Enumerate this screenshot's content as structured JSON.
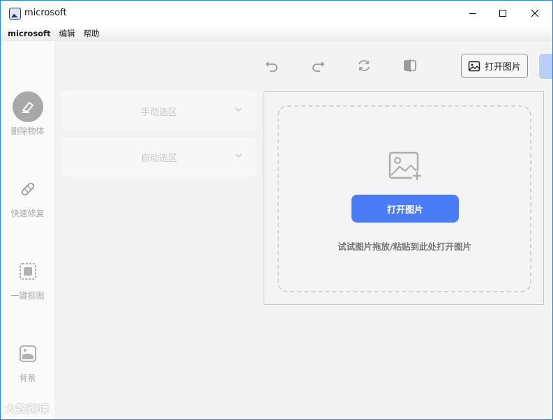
{
  "window": {
    "title": "microsoft"
  },
  "menubar": {
    "app": "microsoft",
    "items": [
      "编辑",
      "帮助"
    ]
  },
  "sidebar": {
    "tools": [
      {
        "label": "删除物体",
        "icon": "eraser-icon"
      },
      {
        "label": "快速修复",
        "icon": "bandage-icon"
      },
      {
        "label": "一键抠图",
        "icon": "cutout-icon"
      },
      {
        "label": "背景",
        "icon": "background-icon"
      }
    ]
  },
  "toolbar": {
    "open_label": "打开图片"
  },
  "panels": {
    "manual": "手动选区",
    "auto": "自动选区"
  },
  "dropzone": {
    "button_label": "打开图片",
    "hint": "试试图片拖放/粘贴到此处打开图片"
  },
  "watermark": "大数跨境",
  "colors": {
    "accent": "#4a7cf7"
  }
}
